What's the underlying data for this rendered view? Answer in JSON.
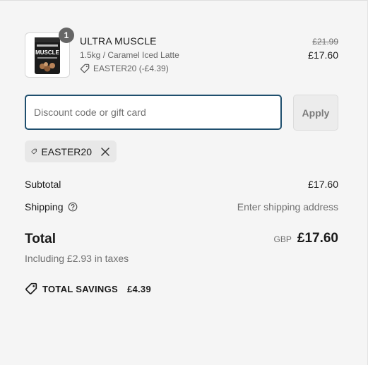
{
  "product": {
    "quantity": "1",
    "name": "ULTRA MUSCLE",
    "variant": "1.5kg / Caramel Iced Latte",
    "discount_line": "EASTER20 (-£4.39)",
    "original_price": "£21.99",
    "price": "£17.60",
    "image_icon": "product-bag-image",
    "image_brand_text": "MUSCLE"
  },
  "discount": {
    "placeholder": "Discount code or gift card",
    "value": "",
    "apply_label": "Apply",
    "applied_code": "EASTER20"
  },
  "summary": {
    "subtotal_label": "Subtotal",
    "subtotal_value": "£17.60",
    "shipping_label": "Shipping",
    "shipping_value": "Enter shipping address",
    "total_label": "Total",
    "currency": "GBP",
    "total_value": "£17.60",
    "taxes_note": "Including £2.93 in taxes",
    "savings_label": "TOTAL SAVINGS",
    "savings_value": "£4.39"
  },
  "colors": {
    "background": "#f5f5f5",
    "input_focus_border": "#1f4f6e",
    "badge": "#666666",
    "muted_text": "#707070"
  }
}
